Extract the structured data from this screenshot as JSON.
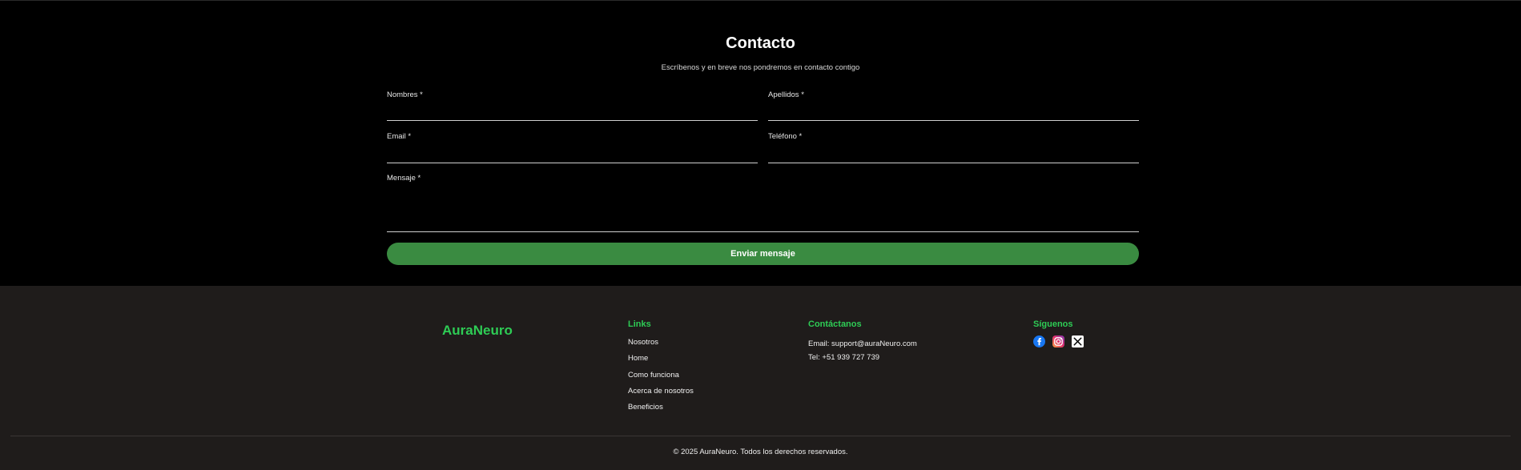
{
  "contact": {
    "title": "Contacto",
    "subtitle": "Escríbenos y en breve nos pondremos en contacto contigo",
    "fields": {
      "first_name": {
        "label": "Nombres *",
        "value": ""
      },
      "last_name": {
        "label": "Apellidos *",
        "value": ""
      },
      "email": {
        "label": "Email *",
        "value": ""
      },
      "phone": {
        "label": "Teléfono *",
        "value": ""
      },
      "message": {
        "label": "Mensaje *",
        "value": ""
      }
    },
    "submit_label": "Enviar mensaje",
    "accent_color": "#3a8b41"
  },
  "footer": {
    "brand": "AuraNeuro",
    "links": {
      "heading": "Links",
      "items": [
        "Nosotros",
        "Home",
        "Como funciona",
        "Acerca de nosotros",
        "Beneficios"
      ]
    },
    "contact": {
      "heading": "Contáctanos",
      "email_line": "Email: support@auraNeuro.com",
      "phone_line": "Tel: +51 939 727 739"
    },
    "social": {
      "heading": "Síguenos",
      "icons": [
        "facebook-icon",
        "instagram-icon",
        "x-icon"
      ]
    },
    "copyright": "© 2025 AuraNeuro. Todos los derechos reservados.",
    "heading_color": "#2ecc55",
    "background_color": "#1f1c1b"
  }
}
